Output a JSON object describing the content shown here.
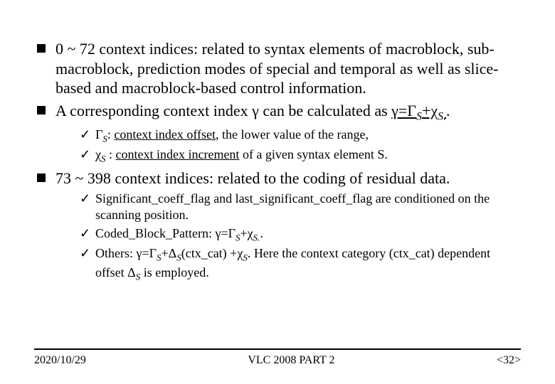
{
  "bullets": {
    "b1": "0 ~ 72 context indices: related to syntax elements of macroblock, sub-macroblock, prediction modes of special and temporal as well as slice-based and macroblock-based control information.",
    "b2_pre": "A corresponding context index γ can be calculated as ",
    "b2_formula": "γ=Γ",
    "b2_plus": "+χ",
    "b2_dot": ".",
    "b3": "73 ~ 398 context indices: related to the coding of residual data."
  },
  "sub1": {
    "s1_sym": "Γ",
    "s1_colon": ": ",
    "s1_u": "context index offset",
    "s1_rest": ", the lower value of the range,",
    "s2_sym": "χ",
    "s2_colon": " : ",
    "s2_u": "context index increment",
    "s2_rest": " of a given syntax element S."
  },
  "sub2": {
    "s1": "Significant_coeff_flag and last_significant_coeff_flag are conditioned on the scanning position.",
    "s2_pre": "Coded_Block_Pattern: γ=Γ",
    "s2_plus": "+χ",
    "s2_dot": ".",
    "s3_pre": "Others: γ=Γ",
    "s3_mid1": "+Δ",
    "s3_mid2": "(ctx_cat) +χ",
    "s3_rest1": ". Here the context category (ctx_cat) dependent offset Δ",
    "s3_rest2": "is employed."
  },
  "S": "S",
  "S_dot": "S.",
  "footer": {
    "date": "2020/10/29",
    "title": "VLC 2008 PART 2",
    "page": "<32>"
  }
}
